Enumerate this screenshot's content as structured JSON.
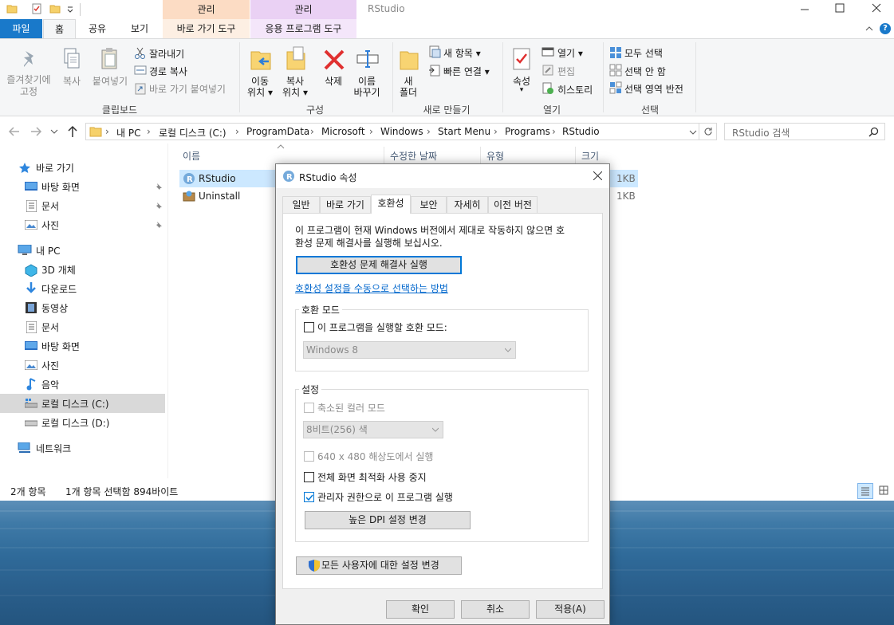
{
  "window": {
    "title": "RStudio",
    "context_tabs": [
      {
        "label": "관리",
        "sublabel": "바로 가기 도구",
        "color": "#fcdcc4",
        "subcolor": "#fdefe3"
      },
      {
        "label": "관리",
        "sublabel": "응용 프로그램 도구",
        "color": "#ead1f4",
        "subcolor": "#f4e6fa"
      }
    ],
    "controls": [
      "minimize-icon",
      "maximize-icon",
      "close-icon"
    ]
  },
  "ribbon_tabs": [
    "파일",
    "홈",
    "공유",
    "보기"
  ],
  "ribbon": {
    "clipboard": {
      "label": "클립보드",
      "pin": "즐겨찾기에\n고정",
      "copy": "복사",
      "paste": "붙여넣기",
      "cut": "잘라내기",
      "copy_path": "경로 복사",
      "paste_shortcut": "바로 가기 붙여넣기"
    },
    "organize": {
      "label": "구성",
      "move_to_1": "이동",
      "move_to_2": "위치",
      "copy_to_1": "복사",
      "copy_to_2": "위치",
      "delete": "삭제",
      "rename_1": "이름",
      "rename_2": "바꾸기"
    },
    "new": {
      "label": "새로 만들기",
      "new_folder_1": "새",
      "new_folder_2": "폴더",
      "new_item": "새 항목",
      "easy_access": "빠른 연결"
    },
    "open": {
      "label": "열기",
      "properties": "속성",
      "open": "열기",
      "edit": "편집",
      "history": "히스토리"
    },
    "select": {
      "label": "선택",
      "select_all": "모두 선택",
      "select_none": "선택 안 함",
      "invert": "선택 영역 반전"
    }
  },
  "address": {
    "crumbs": [
      "내 PC",
      "로컬 디스크 (C:)",
      "ProgramData",
      "Microsoft",
      "Windows",
      "Start Menu",
      "Programs",
      "RStudio"
    ],
    "search_placeholder": "RStudio 검색"
  },
  "nav": {
    "quick_access": "바로 가기",
    "quick_items": [
      "바탕 화면",
      "문서",
      "사진"
    ],
    "this_pc": "내 PC",
    "pc_items": [
      "3D 개체",
      "다운로드",
      "동영상",
      "문서",
      "바탕 화면",
      "사진",
      "음악",
      "로컬 디스크 (C:)",
      "로컬 디스크 (D:)"
    ],
    "network": "네트워크"
  },
  "columns": [
    "이름",
    "수정한 날짜",
    "유형",
    "크기"
  ],
  "files": [
    {
      "name": "RStudio",
      "size": "1KB"
    },
    {
      "name": "Uninstall",
      "size": "1KB"
    }
  ],
  "status": {
    "count": "2개 항목",
    "selection": "1개 항목 선택함 894바이트"
  },
  "dialog": {
    "title": "RStudio 속성",
    "tabs": [
      "일반",
      "바로 가기",
      "호환성",
      "보안",
      "자세히",
      "이전 버전"
    ],
    "selected_tab": 2,
    "intro": "이 프로그램이 현재 Windows 버전에서 제대로 작동하지 않으면 호환성 문제 해결사를 실행해 보십시오.",
    "intro_line1": "이 프로그램이 현재 Windows 버전에서 제대로 작동하지 않으면 호",
    "intro_line2": "환성 문제 해결사를 실행해 보십시오.",
    "troubleshooter_button": "호환성 문제 해결사 실행",
    "manual_link": "호환성 설정을 수동으로 선택하는 방법",
    "compat_mode": {
      "title": "호환 모드",
      "checkbox": "이 프로그램을 실행할 호환 모드:",
      "checked": false,
      "select_value": "Windows 8"
    },
    "settings": {
      "title": "설정",
      "reduced_color": "축소된 컬러 모드",
      "color_value": "8비트(256) 색",
      "res_640": "640 x 480 해상도에서 실행",
      "disable_fullscreen": "전체 화면 최적화 사용 중지",
      "run_as_admin": "관리자 권한으로 이 프로그램 실행",
      "admin_checked": true,
      "dpi_button": "높은 DPI 설정 변경"
    },
    "all_users_button": "모든 사용자에 대한 설정 변경",
    "ok": "확인",
    "cancel": "취소",
    "apply": "적용(A)"
  },
  "colors": {
    "file_tab": "#1979ca",
    "selection": "#cce8ff",
    "nav_selected": "#d9d9d9",
    "accent": "#0078d7"
  }
}
